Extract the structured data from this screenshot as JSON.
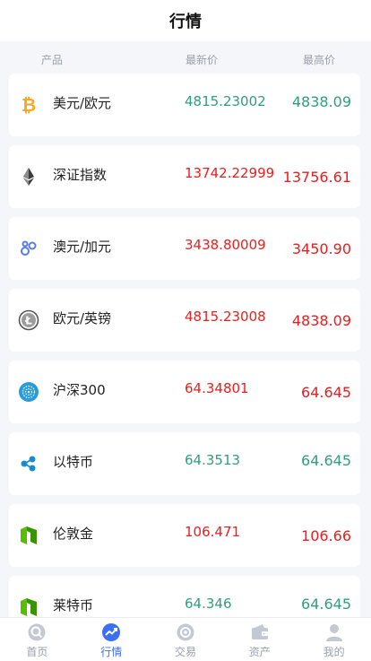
{
  "header": {
    "title": "行情"
  },
  "columns": {
    "product": "产品",
    "latest": "最新价",
    "high": "最高价"
  },
  "rows": [
    {
      "name": "美元/欧元",
      "price": "4815.23002",
      "high": "4838.09",
      "price_color": "green",
      "high_color": "green",
      "icon": "bitcoin-icon"
    },
    {
      "name": "深证指数",
      "price": "13742.22999",
      "high": "13756.61",
      "price_color": "red",
      "high_color": "red",
      "icon": "ethereum-icon"
    },
    {
      "name": "澳元/加元",
      "price": "3438.80009",
      "high": "3450.90",
      "price_color": "red",
      "high_color": "red",
      "icon": "chainlink-icon"
    },
    {
      "name": "欧元/英镑",
      "price": "4815.23008",
      "high": "4838.09",
      "price_color": "red",
      "high_color": "red",
      "icon": "litecoin-icon"
    },
    {
      "name": "沪深300",
      "price": "64.34801",
      "high": "64.645",
      "price_color": "red",
      "high_color": "red",
      "icon": "cardano-icon"
    },
    {
      "name": "以特币",
      "price": "64.3513",
      "high": "64.645",
      "price_color": "green",
      "high_color": "green",
      "icon": "ripple-icon"
    },
    {
      "name": "伦敦金",
      "price": "106.471",
      "high": "106.66",
      "price_color": "red",
      "high_color": "red",
      "icon": "neo-icon"
    },
    {
      "name": "莱特币",
      "price": "64.346",
      "high": "64.645",
      "price_color": "green",
      "high_color": "green",
      "icon": "neo-icon"
    }
  ],
  "tabs": [
    {
      "label": "首页",
      "icon": "home-icon",
      "active": false
    },
    {
      "label": "行情",
      "icon": "market-icon",
      "active": true
    },
    {
      "label": "交易",
      "icon": "trade-icon",
      "active": false
    },
    {
      "label": "资产",
      "icon": "wallet-icon",
      "active": false
    },
    {
      "label": "我的",
      "icon": "user-icon",
      "active": false
    }
  ],
  "colors": {
    "accent": "#3d6ff5",
    "up": "#2f9e7d",
    "down": "#ee1c1c"
  }
}
